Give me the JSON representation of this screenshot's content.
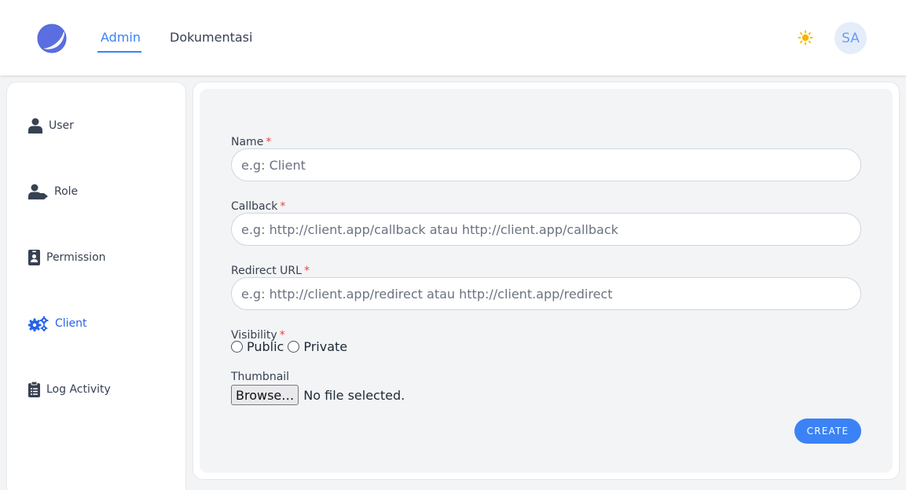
{
  "header": {
    "nav": [
      {
        "label": "Admin",
        "active": true
      },
      {
        "label": "Dokumentasi",
        "active": false
      }
    ],
    "theme_icon": "sun-icon",
    "avatar_initials": "SA",
    "accent_color": "#3b82f6"
  },
  "sidebar": {
    "items": [
      {
        "label": "User",
        "icon": "user-icon",
        "active": false
      },
      {
        "label": "Role",
        "icon": "user-tag-icon",
        "active": false
      },
      {
        "label": "Permission",
        "icon": "id-badge-icon",
        "active": false
      },
      {
        "label": "Client",
        "icon": "cogs-icon",
        "active": true
      },
      {
        "label": "Log Activity",
        "icon": "clipboard-list-icon",
        "active": false
      }
    ]
  },
  "form": {
    "name": {
      "label": "Name",
      "required_mark": "*",
      "placeholder": "e.g: Client",
      "value": ""
    },
    "callback": {
      "label": "Callback",
      "required_mark": "*",
      "placeholder": "e.g: http://client.app/callback atau http://client.app/callback",
      "value": ""
    },
    "redirect": {
      "label": "Redirect URL",
      "required_mark": "*",
      "placeholder": "e.g: http://client.app/redirect atau http://client.app/redirect",
      "value": ""
    },
    "visibility": {
      "label": "Visibility",
      "required_mark": "*",
      "options": [
        "Public",
        "Private"
      ],
      "selected": null
    },
    "thumbnail": {
      "label": "Thumbnail",
      "browse_label": "Browse…",
      "status": "No file selected."
    },
    "submit_label": "CREATE"
  }
}
